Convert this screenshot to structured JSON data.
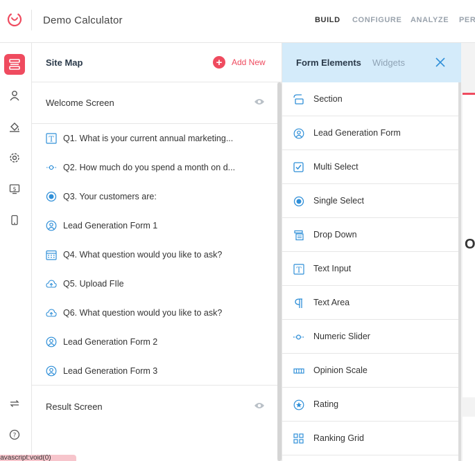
{
  "app": {
    "title": "Demo Calculator",
    "nav": [
      {
        "label": "BUILD",
        "active": true
      },
      {
        "label": "CONFIGURE",
        "active": false
      },
      {
        "label": "ANALYZE",
        "active": false
      },
      {
        "label": "PERI",
        "active": false
      }
    ]
  },
  "rail": {
    "icons": [
      "builder-icon",
      "user-icon",
      "paint-bucket-icon",
      "gear-icon",
      "dollar-screen-icon",
      "mobile-icon",
      "sync-icon",
      "help-icon"
    ]
  },
  "sitemap": {
    "title": "Site Map",
    "add_new": "Add New",
    "welcome": "Welcome Screen",
    "items": [
      {
        "icon": "text-input-icon",
        "label": "Q1. What is your current annual marketing..."
      },
      {
        "icon": "numeric-slider-icon",
        "label": "Q2. How much do you spend a month on d..."
      },
      {
        "icon": "single-select-icon",
        "label": "Q3. Your customers are:"
      },
      {
        "icon": "lead-form-icon",
        "label": "Lead Generation Form 1"
      },
      {
        "icon": "calendar-icon",
        "label": "Q4. What question would you like to ask?"
      },
      {
        "icon": "upload-icon",
        "label": "Q5. Upload FIle"
      },
      {
        "icon": "upload-icon",
        "label": "Q6. What question would you like to ask?"
      },
      {
        "icon": "lead-form-icon",
        "label": "Lead Generation Form 2"
      },
      {
        "icon": "lead-form-icon",
        "label": "Lead Generation Form 3"
      }
    ],
    "result": "Result Screen"
  },
  "form_elements": {
    "tab_active": "Form Elements",
    "tab_inactive": "Widgets",
    "items": [
      {
        "icon": "section-icon",
        "label": "Section"
      },
      {
        "icon": "lead-form-icon",
        "label": "Lead Generation Form"
      },
      {
        "icon": "multi-select-icon",
        "label": "Multi Select"
      },
      {
        "icon": "single-select-icon",
        "label": "Single Select"
      },
      {
        "icon": "dropdown-icon",
        "label": "Drop Down"
      },
      {
        "icon": "text-input-icon",
        "label": "Text Input"
      },
      {
        "icon": "text-area-icon",
        "label": "Text Area"
      },
      {
        "icon": "numeric-slider-icon",
        "label": "Numeric Slider"
      },
      {
        "icon": "opinion-scale-icon",
        "label": "Opinion Scale"
      },
      {
        "icon": "rating-icon",
        "label": "Rating"
      },
      {
        "icon": "ranking-grid-icon",
        "label": "Ranking Grid"
      }
    ]
  },
  "canvas": {
    "text": "O"
  },
  "status_tip": "javascript:void(0)",
  "colors": {
    "accent": "#ef4b5f",
    "primary": "#2f8fd8",
    "panel_header": "#d4ebfa"
  }
}
